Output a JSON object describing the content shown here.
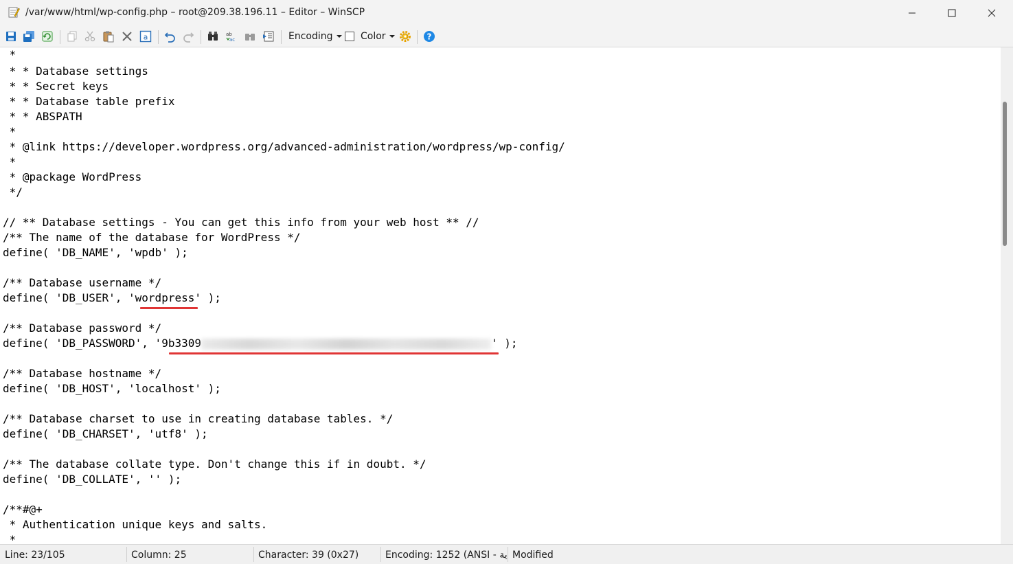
{
  "window": {
    "title": "/var/www/html/wp-config.php – root@209.38.196.11 – Editor – WinSCP"
  },
  "toolbar": {
    "encoding_label": "Encoding",
    "color_label": "Color",
    "icons": [
      "save-icon",
      "save-all-icon",
      "reload-icon",
      "copy-icon",
      "cut-icon",
      "paste-icon",
      "delete-icon",
      "select-all-icon",
      "undo-icon",
      "redo-icon",
      "find-icon",
      "replace-icon",
      "find-next-icon",
      "goto-line-icon",
      "settings-icon",
      "help-icon"
    ]
  },
  "editor": {
    "lines": [
      {
        "text": " *"
      },
      {
        "text": " * * Database settings"
      },
      {
        "text": " * * Secret keys"
      },
      {
        "text": " * * Database table prefix"
      },
      {
        "text": " * * ABSPATH"
      },
      {
        "text": " *"
      },
      {
        "text": " * @link https://developer.wordpress.org/advanced-administration/wordpress/wp-config/"
      },
      {
        "text": " *"
      },
      {
        "text": " * @package WordPress"
      },
      {
        "text": " */"
      },
      {
        "text": ""
      },
      {
        "text": "// ** Database settings - You can get this info from your web host ** //"
      },
      {
        "text": "/** The name of the database for WordPress */"
      },
      {
        "text": "define( 'DB_NAME', 'wpdb' );"
      },
      {
        "text": ""
      },
      {
        "text": "/** Database username */"
      },
      {
        "text": "define( 'DB_USER', 'wordpress' );"
      },
      {
        "text": ""
      },
      {
        "text": "/** Database password */"
      },
      {
        "text": "define( 'DB_PASSWORD', '9b3309"
      },
      {
        "text": ""
      },
      {
        "text": "/** Database hostname */"
      },
      {
        "text": "define( 'DB_HOST', 'localhost' );"
      },
      {
        "text": ""
      },
      {
        "text": "/** Database charset to use in creating database tables. */"
      },
      {
        "text": "define( 'DB_CHARSET', 'utf8' );"
      },
      {
        "text": ""
      },
      {
        "text": "/** The database collate type. Don't change this if in doubt. */"
      },
      {
        "text": "define( 'DB_COLLATE', '' );"
      },
      {
        "text": ""
      },
      {
        "text": "/**#@+"
      },
      {
        "text": " * Authentication unique keys and salts."
      },
      {
        "text": " *"
      }
    ],
    "password_suffix": "' );"
  },
  "status": {
    "line": "Line: 23/105",
    "column": "Column: 25",
    "character": "Character: 39 (0x27)",
    "encoding": "Encoding: 1252  (ANSI - ية",
    "modified": "Modified"
  },
  "colors": {
    "annotation_red": "#e03535",
    "help_blue": "#1e88e5",
    "save_blue": "#1e6fbf"
  }
}
